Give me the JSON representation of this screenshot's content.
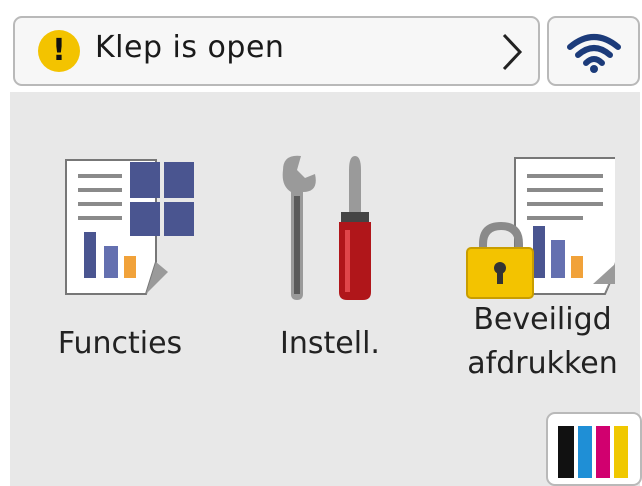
{
  "status": {
    "message": "Klep is open",
    "icon": "warning-icon",
    "warning_color": "#f3c300"
  },
  "wifi": {
    "icon": "wifi-icon",
    "color": "#1c3b7a"
  },
  "tiles": [
    {
      "label": "Functies",
      "icon": "functions-document-icon"
    },
    {
      "label": "Instell.",
      "icon": "settings-tools-icon"
    },
    {
      "label_line1": "Beveiligd",
      "label_line2": "afdrukken",
      "icon": "secure-print-lock-icon"
    }
  ],
  "ink": {
    "icon": "ink-cartridges-icon",
    "colors": [
      "#111111",
      "#1f8fd6",
      "#d1006f",
      "#f0c800"
    ]
  }
}
